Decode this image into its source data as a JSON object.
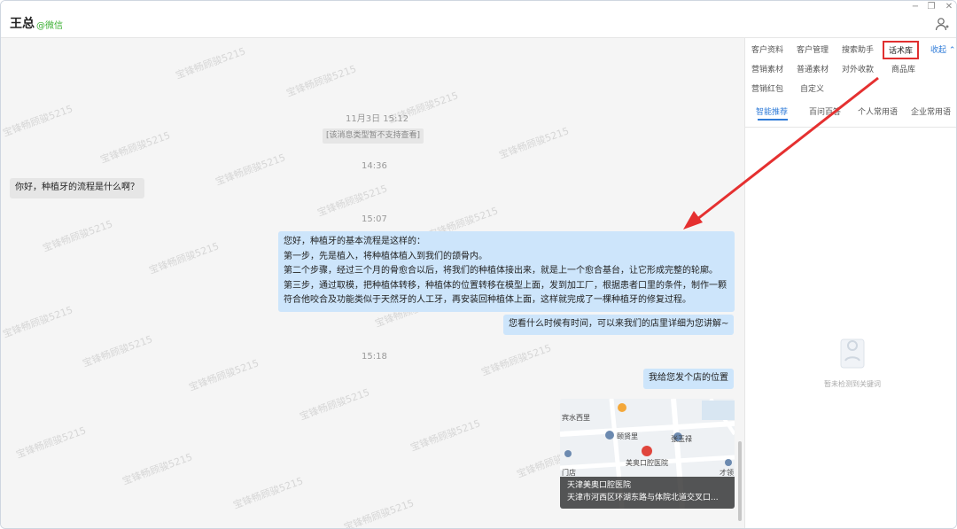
{
  "header": {
    "contact_name": "王总",
    "contact_source": "@微信",
    "window_controls": [
      "−",
      "❐",
      "✕"
    ]
  },
  "chat": {
    "messages": [
      {
        "kind": "time",
        "text": "11月3日 15:12"
      },
      {
        "kind": "system",
        "text": "[该消息类型暂不支持查看]"
      },
      {
        "kind": "time",
        "text": "14:36"
      },
      {
        "kind": "incoming",
        "text": "你好，种植牙的流程是什么啊？"
      },
      {
        "kind": "time",
        "text": "15:07"
      },
      {
        "kind": "outgoing",
        "lines": [
          "您好，种植牙的基本流程是这样的：",
          "第一步，先是植入，将种植体植入到我们的颌骨内。",
          "第二个步骤，经过三个月的骨愈合以后，将我们的种植体接出来，就是上一个愈合基台，让它形成完整的轮廓。",
          "第三步，通过取模，把种植体转移，种植体的位置转移在模型上面，发到加工厂，根据患者口里的条件，制作一颗",
          "符合他咬合及功能类似于天然牙的人工牙，再安装回种植体上面，这样就完成了一棵种植牙的修复过程。"
        ]
      },
      {
        "kind": "outgoing",
        "text": "您看什么时候有时间，可以来我们的店里详细为您讲解~"
      },
      {
        "kind": "time",
        "text": "15:18"
      },
      {
        "kind": "outgoing",
        "text": "我给您发个店的位置"
      },
      {
        "kind": "location",
        "name": "天津美奥口腔医院",
        "address": "天津市河西区环湖东路与体院北道交叉口...",
        "map_labels": [
          "宾水西里",
          "颐贤里",
          "张玉禄",
          "美奥口腔医院",
          "门店",
          "才领"
        ]
      }
    ],
    "watermark": "宝锋畅顾骏5215"
  },
  "sidebar": {
    "tools_row1": [
      "客户资料",
      "客户管理",
      "搜索助手",
      "话术库"
    ],
    "active_tool": "话术库",
    "collapse_label": "收起 ⌃",
    "tools_row2": [
      "营销素材",
      "普通素材",
      "对外收款",
      "商品库"
    ],
    "tools_row3": [
      "营销红包",
      "自定义"
    ],
    "subtabs": [
      "智能推荐",
      "百问百答",
      "个人常用语",
      "企业常用语"
    ],
    "active_subtab": "智能推荐",
    "empty_text": "暂未检测到关键词"
  },
  "colors": {
    "outgoing_bubble": "#cde5fb",
    "incoming_bubble": "#e6e6e6",
    "accent": "#2f7bd8",
    "highlight_red": "#e03030",
    "wechat_green": "#3cb034"
  }
}
